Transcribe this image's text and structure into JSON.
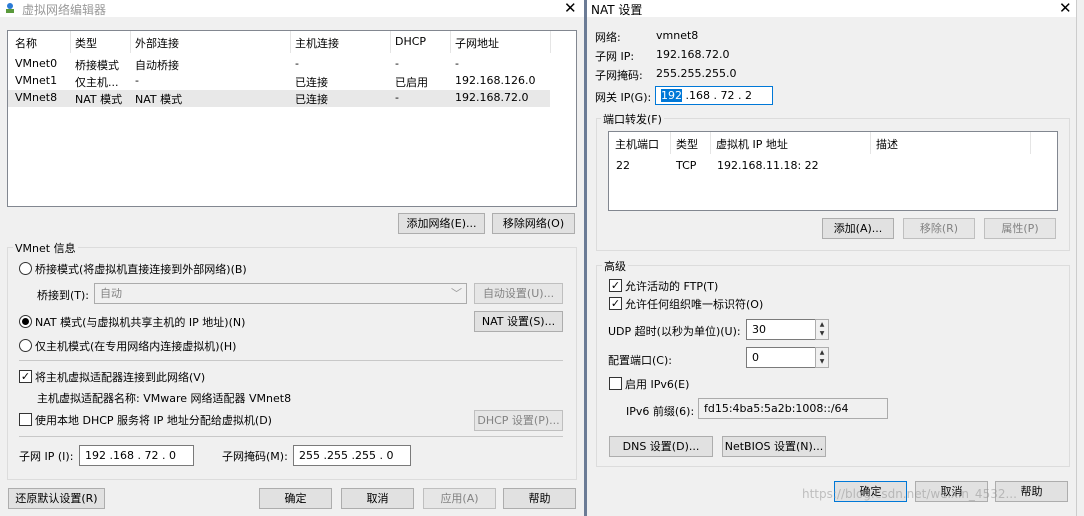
{
  "left": {
    "title": "虚拟网络编辑器",
    "close": "✕",
    "table": {
      "headers": [
        "名称",
        "类型",
        "外部连接",
        "主机连接",
        "DHCP",
        "子网地址"
      ],
      "rows": [
        [
          "VMnet0",
          "桥接模式",
          "自动桥接",
          "-",
          "-",
          "-"
        ],
        [
          "VMnet1",
          "仅主机...",
          "-",
          "已连接",
          "已启用",
          "192.168.126.0"
        ],
        [
          "VMnet8",
          "NAT 模式",
          "NAT 模式",
          "已连接",
          "-",
          "192.168.72.0"
        ]
      ]
    },
    "add_network": "添加网络(E)...",
    "remove_network": "移除网络(O)",
    "info_title": "VMnet 信息",
    "bridge_mode": "桥接模式(将虚拟机直接连接到外部网络)(B)",
    "bridge_to_label": "桥接到(T):",
    "bridge_to_value": "自动",
    "auto_settings": "自动设置(U)...",
    "nat_mode": "NAT 模式(与虚拟机共享主机的 IP 地址)(N)",
    "nat_settings": "NAT 设置(S)...",
    "host_only": "仅主机模式(在专用网络内连接虚拟机)(H)",
    "connect_adapter": "将主机虚拟适配器连接到此网络(V)",
    "adapter_name": "主机虚拟适配器名称: VMware 网络适配器 VMnet8",
    "use_dhcp": "使用本地 DHCP 服务将 IP 地址分配给虚拟机(D)",
    "dhcp_settings": "DHCP 设置(P)...",
    "subnet_ip_label": "子网 IP (I):",
    "subnet_ip": "192 .168 . 72  .  0",
    "subnet_mask_label": "子网掩码(M):",
    "subnet_mask": "255 .255 .255 .  0",
    "restore": "还原默认设置(R)",
    "ok": "确定",
    "cancel": "取消",
    "apply": "应用(A)",
    "help": "帮助"
  },
  "nat": {
    "title": "NAT 设置",
    "close": "✕",
    "network_label": "网络:",
    "network_value": "vmnet8",
    "subnet_ip_label": "子网 IP:",
    "subnet_ip_value": "192.168.72.0",
    "subnet_mask_label": "子网掩码:",
    "subnet_mask_value": "255.255.255.0",
    "gateway_label": "网关 IP(G):",
    "gateway_first": "192",
    "gateway_rest": " .168 . 72  .  2",
    "port_forward_title": "端口转发(F)",
    "pf_headers": [
      "主机端口",
      "类型",
      "虚拟机 IP 地址",
      "描述"
    ],
    "pf_rows": [
      [
        "22",
        "TCP",
        "192.168.11.18: 22",
        ""
      ]
    ],
    "pf_add": "添加(A)...",
    "pf_remove": "移除(R)",
    "pf_props": "属性(P)",
    "advanced_title": "高级",
    "allow_ftp": "允许活动的 FTP(T)",
    "allow_oui": "允许任何组织唯一标识符(O)",
    "udp_timeout_label": "UDP 超时(以秒为单位)(U):",
    "udp_timeout": "30",
    "config_port_label": "配置端口(C):",
    "config_port": "0",
    "enable_ipv6": "启用 IPv6(E)",
    "ipv6_prefix_label": "IPv6 前缀(6):",
    "ipv6_prefix": "fd15:4ba5:5a2b:1008::/64",
    "dns": "DNS 设置(D)...",
    "netbios": "NetBIOS 设置(N)...",
    "ok": "确定",
    "cancel": "取消",
    "help": "帮助",
    "watermark": "https://blog.csdn.net/weixin_4532..."
  }
}
